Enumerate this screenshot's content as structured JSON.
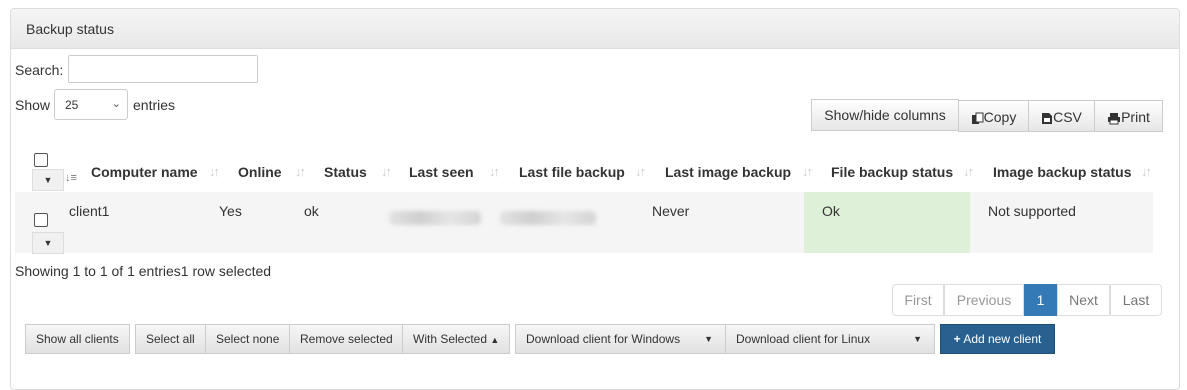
{
  "panel": {
    "title": "Backup status"
  },
  "search": {
    "label": "Search:",
    "value": ""
  },
  "length": {
    "show": "Show",
    "value": "25",
    "entries": "entries"
  },
  "buttons": {
    "colvis": "Show/hide columns",
    "copy": "Copy",
    "csv": "CSV",
    "print": "Print"
  },
  "table": {
    "headers": [
      "Computer name",
      "Online",
      "Status",
      "Last seen",
      "Last file backup",
      "Last image backup",
      "File backup status",
      "Image backup status"
    ],
    "rows": [
      {
        "computer_name": "client1",
        "online": "Yes",
        "status": "ok",
        "last_image_backup": "Never",
        "file_backup_status": "Ok",
        "image_backup_status": "Not supported"
      }
    ]
  },
  "info": "Showing 1 to 1 of 1 entries1 row selected",
  "pagination": {
    "first": "First",
    "previous": "Previous",
    "page": "1",
    "next": "Next",
    "last": "Last"
  },
  "bottom": {
    "show_all": "Show all clients",
    "select_all": "Select all",
    "select_none": "Select none",
    "remove_selected": "Remove selected",
    "with_selected": "With Selected",
    "download_windows": "Download client for Windows",
    "download_linux": "Download client for Linux",
    "add_new": "Add new client"
  },
  "colors": {
    "ok_cell": "#dff0d8",
    "primary": "#286090",
    "active_page": "#337ab7"
  },
  "icons": {
    "copy": "copy-icon",
    "csv": "csv-icon",
    "print": "print-icon",
    "add": "plus-icon",
    "sort": "sort-icon"
  }
}
